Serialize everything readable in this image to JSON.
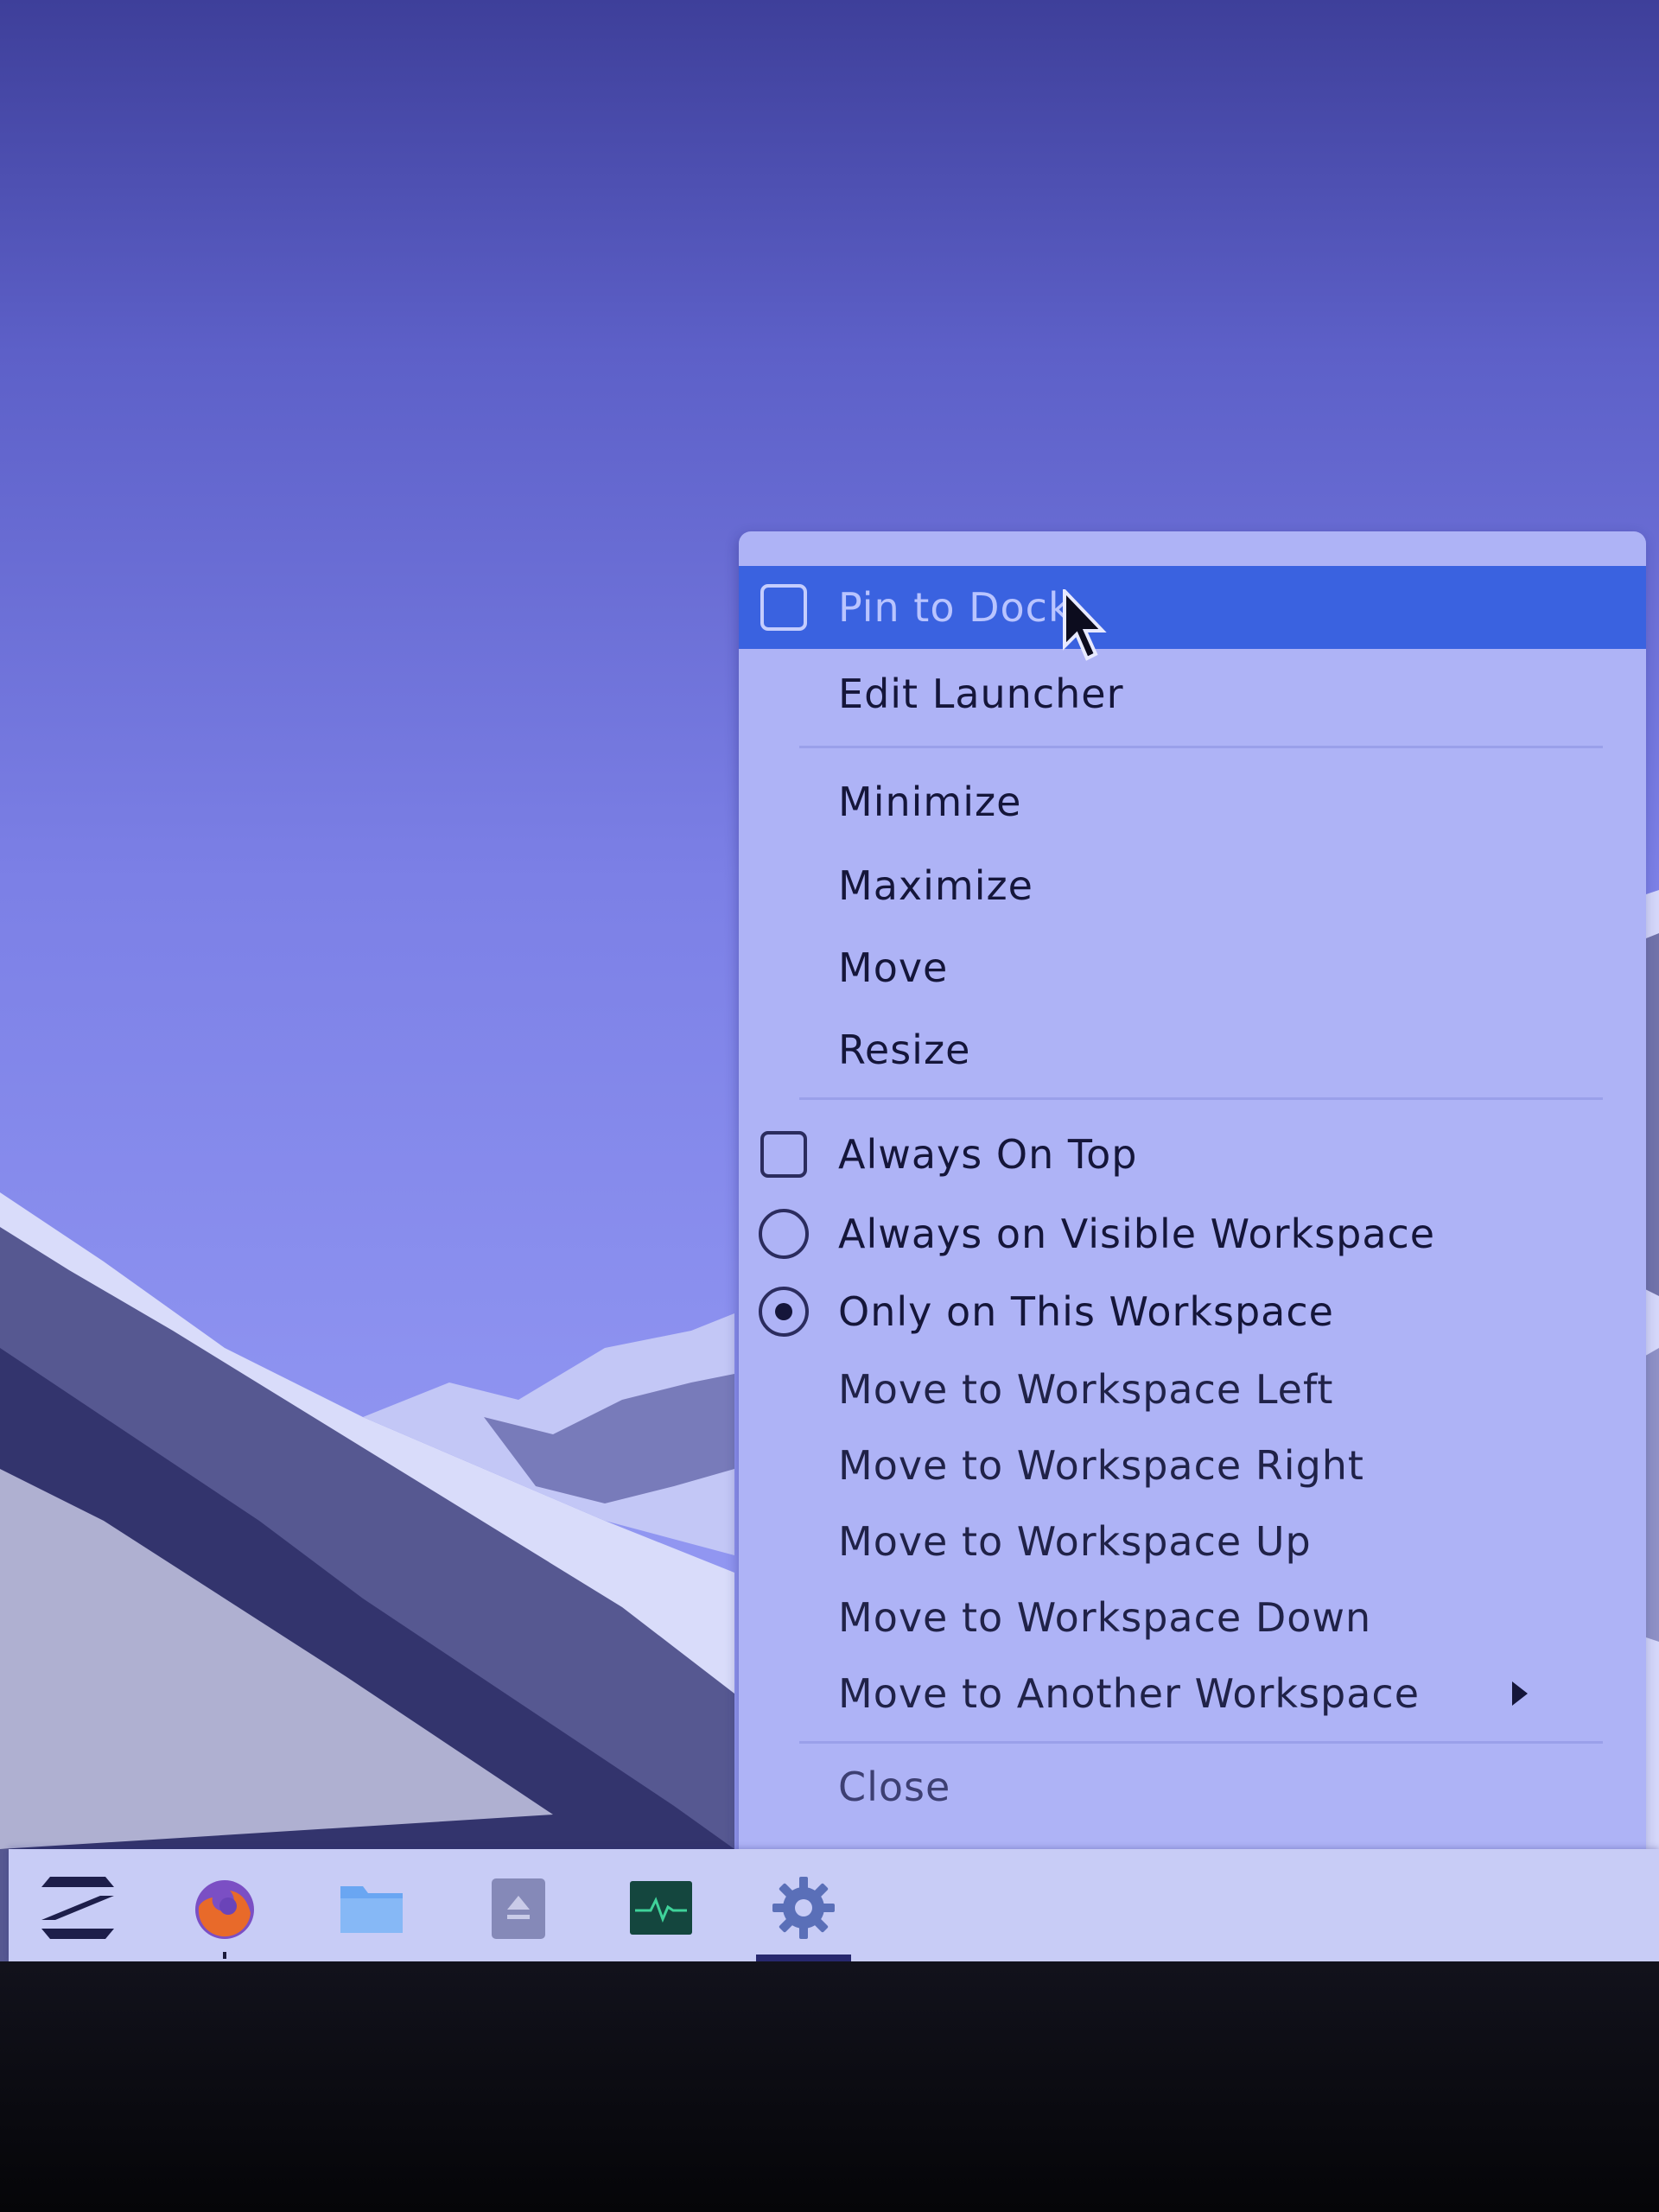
{
  "menu": {
    "pin_to_dock": "Pin to Dock",
    "edit_launcher": "Edit Launcher",
    "minimize": "Minimize",
    "maximize": "Maximize",
    "move": "Move",
    "resize": "Resize",
    "always_on_top": "Always On Top",
    "always_on_visible_workspace": "Always on Visible Workspace",
    "only_on_this_workspace": "Only on This Workspace",
    "move_to_workspace_left": "Move to Workspace Left",
    "move_to_workspace_right": "Move to Workspace Right",
    "move_to_workspace_up": "Move to Workspace Up",
    "move_to_workspace_down": "Move to Workspace Down",
    "move_to_another_workspace": "Move to Another Workspace",
    "close": "Close"
  },
  "state": {
    "pin_to_dock_checked": false,
    "always_on_top_checked": false,
    "workspace_mode": "only_on_this_workspace",
    "highlighted_item": "pin_to_dock"
  },
  "dock": {
    "items": [
      {
        "icon": "zorin-menu-icon"
      },
      {
        "icon": "firefox-icon"
      },
      {
        "icon": "files-folder-icon"
      },
      {
        "icon": "software-store-icon"
      },
      {
        "icon": "system-monitor-icon"
      },
      {
        "icon": "settings-gear-icon"
      }
    ]
  },
  "colors": {
    "highlight": "#3a62e0",
    "menu_bg": "#aeb3f6",
    "text": "#15163a"
  }
}
